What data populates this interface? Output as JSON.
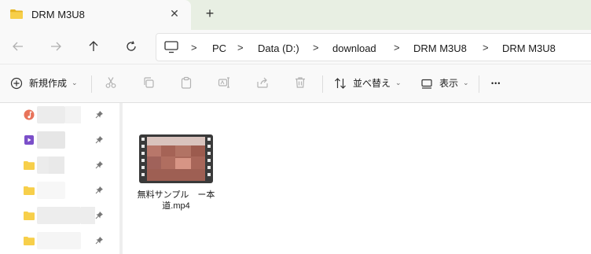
{
  "tab": {
    "title": "DRM M3U8",
    "close_glyph": "✕",
    "new_tab_glyph": "+"
  },
  "nav": {
    "back_icon": "arrow-left-icon",
    "forward_icon": "arrow-right-icon",
    "up_icon": "arrow-up-icon",
    "refresh_icon": "refresh-icon"
  },
  "address": {
    "crumbs": [
      "PC",
      "Data (D:)",
      "download",
      "DRM M3U8",
      "DRM M3U8"
    ],
    "separator": ">"
  },
  "toolbar": {
    "new_label": "新規作成",
    "sort_label": "並べ替え",
    "view_label": "表示",
    "more_glyph": "•••"
  },
  "file": {
    "name": "無料サンプル　ー本道.mp4"
  },
  "colors": {
    "folder": "#f4c430",
    "accent": "#0067c0",
    "tab_strip": "#e8efe3"
  }
}
